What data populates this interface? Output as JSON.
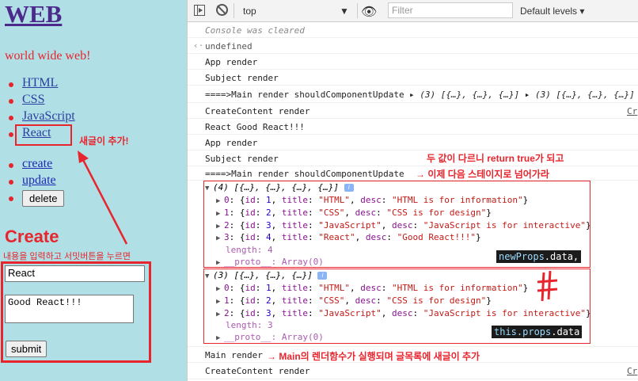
{
  "page": {
    "title": "WEB",
    "tagline": "world wide web!",
    "nav_items": [
      "HTML",
      "CSS",
      "JavaScript",
      "React"
    ],
    "control_links": [
      "create",
      "update"
    ],
    "delete_label": "delete",
    "create_heading": "Create",
    "title_value": "React",
    "desc_value": "Good React!!!",
    "submit_label": "submit"
  },
  "annotations": {
    "new_post": "새글이 추가!",
    "submit_note": "내용을 입력하고 서밋버튼을 누르면",
    "diff_note": "두 값이 다르니 return true가 되고",
    "next_stage": "→ 이제 다음 스테이지로 넘어가라",
    "main_render_note": "→ Main의 렌더함수가 실행되며 글목록에 새글이 추가"
  },
  "devtools": {
    "context": "top",
    "filter_placeholder": "Filter",
    "levels": "Default levels",
    "log_lines": {
      "cleared": "Console was cleared",
      "undefined": "undefined",
      "app_render": "App render",
      "subject_render": "Subject render",
      "main_scu": "====>Main render shouldComponentUpdate",
      "scu_args": "(3) [{…}, {…}, {…}] ▸ (3) [{…}, {…}, {…}]",
      "create_content": "CreateContent render",
      "react_good": "React Good React!!!",
      "main_render": "Main render",
      "source_link": "Cr"
    },
    "new_props": {
      "header": "(4) [{…}, {…}, {…}, {…}]",
      "items": [
        {
          "idx": "0",
          "id": "1",
          "title": "\"HTML\"",
          "desc": "\"HTML is for information\""
        },
        {
          "idx": "1",
          "id": "2",
          "title": "\"CSS\"",
          "desc": "\"CSS is for design\""
        },
        {
          "idx": "2",
          "id": "3",
          "title": "\"JavaScript\"",
          "desc": "\"JavaScript is for interactive\""
        },
        {
          "idx": "3",
          "id": "4",
          "title": "\"React\"",
          "desc": "\"Good React!!!\""
        }
      ],
      "length_label": "length: 4",
      "label_obj": "newProps",
      "label_prop": ".data,"
    },
    "this_props": {
      "header": "(3) [{…}, {…}, {…}]",
      "items": [
        {
          "idx": "0",
          "id": "1",
          "title": "\"HTML\"",
          "desc": "\"HTML is for information\""
        },
        {
          "idx": "1",
          "id": "2",
          "title": "\"CSS\"",
          "desc": "\"CSS is for design\""
        },
        {
          "idx": "2",
          "id": "3",
          "title": "\"JavaScript\"",
          "desc": "\"JavaScript is for interactive\""
        }
      ],
      "length_label": "length: 3",
      "label_obj": "this.props",
      "label_prop": ".data"
    },
    "proto_label": "__proto__: Array(0)"
  }
}
